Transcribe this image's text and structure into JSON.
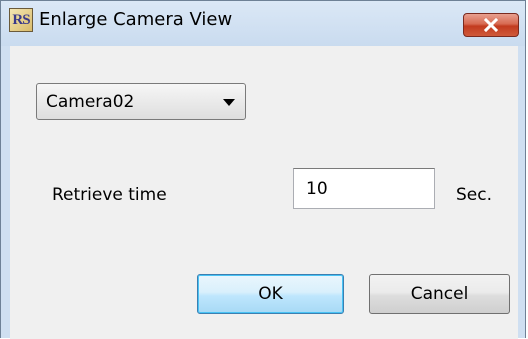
{
  "window": {
    "title": "Enlarge Camera View",
    "icon_text": "RS"
  },
  "camera_select": {
    "selected": "Camera02"
  },
  "retrieve": {
    "label": "Retrieve time",
    "value": "10",
    "unit": "Sec."
  },
  "buttons": {
    "ok": "OK",
    "cancel": "Cancel"
  },
  "icons": {
    "app": "app-logo-icon",
    "close": "close-icon",
    "dropdown": "chevron-down-icon"
  },
  "colors": {
    "close_button": "#c23b1f",
    "ok_border": "#3c7fb1",
    "frame": "#cfdff1"
  }
}
